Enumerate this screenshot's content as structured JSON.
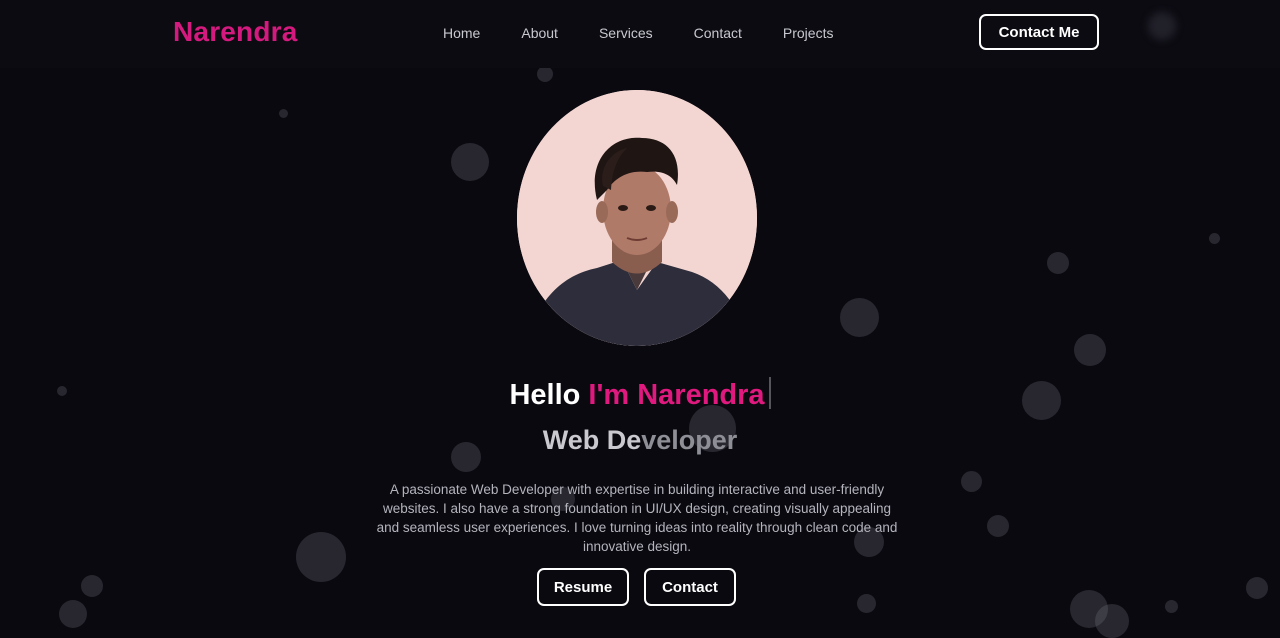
{
  "brand": {
    "name": "Narendra"
  },
  "nav": {
    "items": [
      "Home",
      "About",
      "Services",
      "Contact",
      "Projects"
    ]
  },
  "header": {
    "cta_label": "Contact Me"
  },
  "hero": {
    "greeting_prefix": "Hello ",
    "greeting_name": "I'm Narendra",
    "role_bright": "Web De",
    "role_faded": "veloper",
    "bio": "A passionate Web Developer with expertise in building interactive and user-friendly websites. I also have a strong foundation in UI/UX design, creating visually appealing and seamless user experiences. I love turning ideas into reality through clean code and innovative design.",
    "buttons": {
      "resume": "Resume",
      "contact": "Contact"
    }
  },
  "colors": {
    "accent": "#e0197f",
    "background": "#0a0910",
    "avatar_bg": "#f3d6d2"
  },
  "icons": {
    "avatar": "profile-photo"
  }
}
